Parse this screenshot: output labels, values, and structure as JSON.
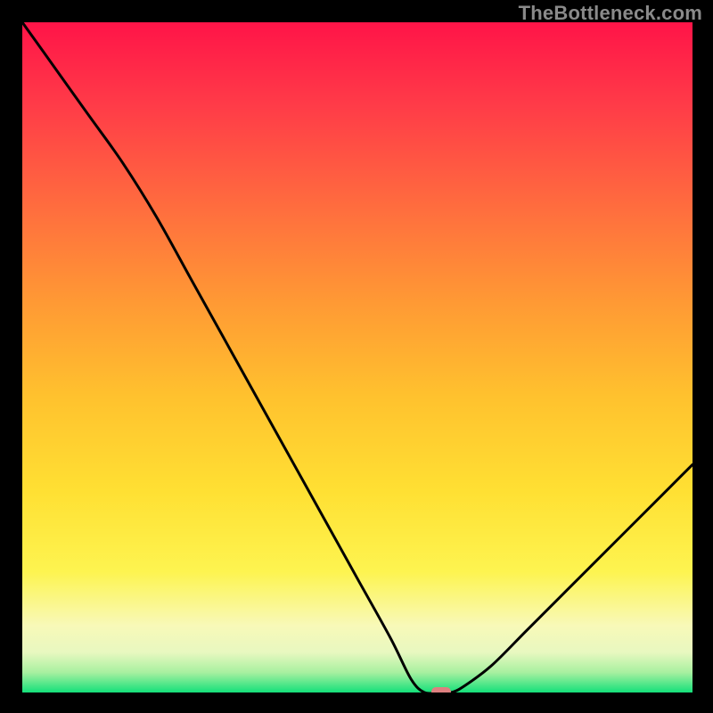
{
  "watermark": "TheBottleneck.com",
  "chart_data": {
    "type": "line",
    "title": "",
    "xlabel": "",
    "ylabel": "",
    "x": [
      0.0,
      0.05,
      0.1,
      0.15,
      0.2,
      0.25,
      0.3,
      0.35,
      0.4,
      0.45,
      0.5,
      0.55,
      0.58,
      0.6,
      0.62,
      0.64,
      0.66,
      0.7,
      0.75,
      0.8,
      0.85,
      0.9,
      0.95,
      1.0
    ],
    "y": [
      1.0,
      0.93,
      0.86,
      0.79,
      0.71,
      0.62,
      0.53,
      0.44,
      0.35,
      0.26,
      0.17,
      0.08,
      0.02,
      0.0,
      0.0,
      0.0,
      0.01,
      0.04,
      0.09,
      0.14,
      0.19,
      0.24,
      0.29,
      0.34
    ],
    "xlim": [
      0,
      1
    ],
    "ylim": [
      0,
      1
    ],
    "grid": false,
    "marker": {
      "x": 0.625,
      "y": 0.0,
      "shape": "rounded-rect",
      "color": "#de7f7f"
    },
    "background_gradient": {
      "top": "#ff1a4a",
      "mid_upper": "#ffb030",
      "mid_lower": "#ffe940",
      "pale_band": "#f8f9c8",
      "bottom": "#14e07a"
    }
  }
}
